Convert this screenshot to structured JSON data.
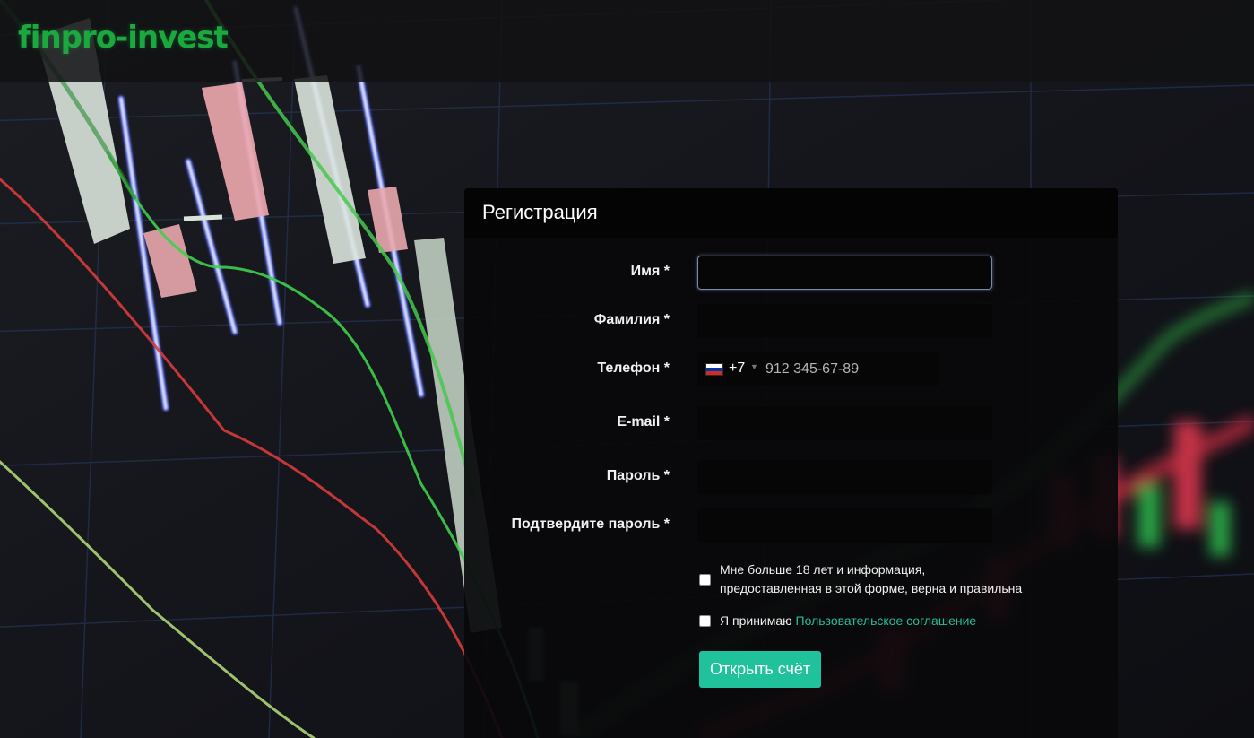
{
  "header": {
    "logo_text": "finpro-invest"
  },
  "form": {
    "title": "Регистрация",
    "fields": {
      "first_name": {
        "label": "Имя *",
        "value": ""
      },
      "last_name": {
        "label": "Фамилия *",
        "value": ""
      },
      "phone": {
        "label": "Телефон *",
        "country_code": "+7",
        "placeholder": "912 345-67-89",
        "flag_icon": "russia-flag-icon"
      },
      "email": {
        "label": "E-mail *",
        "value": ""
      },
      "password": {
        "label": "Пароль *",
        "value": ""
      },
      "password_confirm": {
        "label": "Подтвердите пароль *",
        "value": ""
      }
    },
    "consent_age": {
      "text_line1": "Мне больше 18 лет и информация,",
      "text_line2": "предоставленная в этой форме, верна и правильна",
      "checked": false
    },
    "consent_terms": {
      "text": "Я принимаю",
      "link_text": "Пользовательское соглашение",
      "checked": false
    },
    "submit_label": "Открыть счёт"
  },
  "colors": {
    "accent": "#1fc29a",
    "link": "#25bd96",
    "logo": "#1aa83f",
    "panel": "#09090b"
  }
}
